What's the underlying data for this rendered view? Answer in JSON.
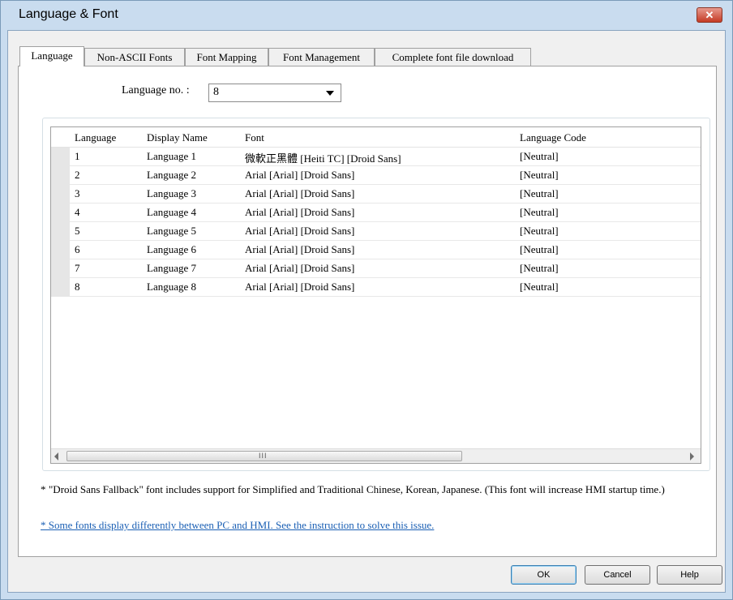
{
  "window": {
    "title": "Language & Font",
    "close_glyph": "✕"
  },
  "tabs": [
    {
      "label": "Language",
      "active": true
    },
    {
      "label": "Non-ASCII Fonts",
      "active": false
    },
    {
      "label": "Font Mapping",
      "active": false
    },
    {
      "label": "Font Management",
      "active": false
    },
    {
      "label": "Complete font file download",
      "active": false
    }
  ],
  "language_no": {
    "label": "Language no. :",
    "value": "8"
  },
  "table": {
    "columns": [
      "Language",
      "Display Name",
      "Font",
      "Language Code"
    ],
    "rows": [
      [
        "1",
        "Language 1",
        "微軟正黑體 [Heiti TC] [Droid Sans]",
        "[Neutral]"
      ],
      [
        "2",
        "Language 2",
        "Arial [Arial] [Droid Sans]",
        "[Neutral]"
      ],
      [
        "3",
        "Language 3",
        "Arial [Arial] [Droid Sans]",
        "[Neutral]"
      ],
      [
        "4",
        "Language 4",
        "Arial [Arial] [Droid Sans]",
        "[Neutral]"
      ],
      [
        "5",
        "Language 5",
        "Arial [Arial] [Droid Sans]",
        "[Neutral]"
      ],
      [
        "6",
        "Language 6",
        "Arial [Arial] [Droid Sans]",
        "[Neutral]"
      ],
      [
        "7",
        "Language 7",
        "Arial [Arial] [Droid Sans]",
        "[Neutral]"
      ],
      [
        "8",
        "Language 8",
        "Arial [Arial] [Droid Sans]",
        "[Neutral]"
      ]
    ],
    "scrollbar_grip": "III"
  },
  "note": {
    "star": "*",
    "text": "\"Droid Sans Fallback\" font includes support for Simplified and Traditional Chinese, Korean, Japanese. (This font will increase HMI startup time.)"
  },
  "link": "* Some fonts display differently between PC and HMI. See the instruction to solve this issue.",
  "buttons": {
    "ok": "OK",
    "cancel": "Cancel",
    "help": "Help"
  },
  "colors": {
    "title_bar": "#c9dcef",
    "close_button": "#c53b25",
    "link": "#1a5fb4"
  }
}
